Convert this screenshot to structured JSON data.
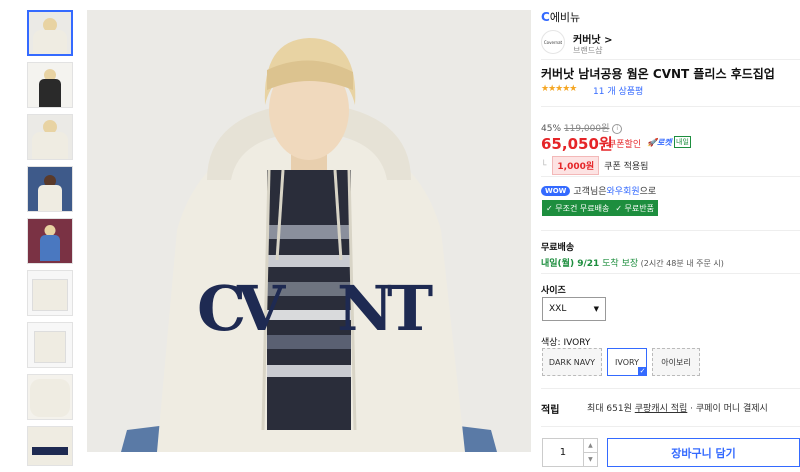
{
  "brand_bar": {
    "logo": "C",
    "label": "에비뉴"
  },
  "brand": {
    "logo_text": "Covernat",
    "name": "커버낫 >",
    "shop": "브랜드샵"
  },
  "product": {
    "title": "커버낫 남녀공용 웜온 CVNT 플리스 후드집업",
    "stars": "★★★★★",
    "reviews": "11 개 상품평"
  },
  "price": {
    "discount": "45%",
    "original": "119,000원",
    "current": "65,050원",
    "coupon_discount": "쿠폰할인",
    "rocket": "🚀로켓",
    "next_day": "내일",
    "coupon_amount": "1,000원",
    "coupon_applied": "쿠폰 적용됨"
  },
  "wow": {
    "badge": "WOW",
    "text_before": "고객님은 ",
    "link": "와우회원",
    "text_after": "으로",
    "benefits": [
      "✓ 무조건 무료배송",
      "✓ 무료반품"
    ]
  },
  "shipping": {
    "label": "무료배송",
    "date": "내일(월) 9/21",
    "guarantee": " 도착 보장",
    "note": " (2시간 48분 내 주문 시)"
  },
  "size": {
    "label": "사이즈",
    "selected": "XXL"
  },
  "color": {
    "label": "색상: IVORY",
    "options": [
      "DARK NAVY",
      "IVORY",
      "아이보리"
    ],
    "selected_index": 1
  },
  "reward": {
    "label": "적립",
    "text_pre": "최대 651원 ",
    "link": "쿠팡캐시 적립",
    "text_post": " · 쿠페이 머니 결제시"
  },
  "purchase": {
    "quantity": "1",
    "cart_label": "장바구니 담기"
  },
  "colors": {
    "accent": "#346aff",
    "price_red": "#e52528",
    "green": "#1d8e3e",
    "hoodie": "#efece2",
    "navy": "#1e2a52"
  }
}
